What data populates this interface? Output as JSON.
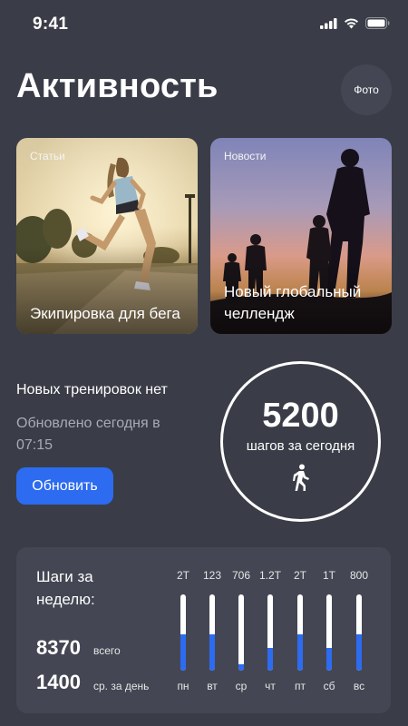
{
  "status_bar": {
    "time": "9:41",
    "icons": [
      "cellular-signal-icon",
      "wifi-icon",
      "battery-icon"
    ]
  },
  "header": {
    "title": "Активность",
    "photo_button": "Фото"
  },
  "cards": [
    {
      "category": "Статьи",
      "title": "Экипировка для бега",
      "image": "runner-sunset-photo"
    },
    {
      "category": "Новости",
      "title": "Новый глобальный челлендж",
      "image": "silhouettes-sunset-photo"
    }
  ],
  "workout": {
    "status": "Новых тренировок нет",
    "updated": "Обновлено сегодня в 07:15",
    "refresh_button": "Обновить"
  },
  "steps": {
    "count": "5200",
    "label": "шагов за сегодня",
    "icon": "walking-person-icon"
  },
  "weekly": {
    "title": "Шаги за неделю:",
    "total_value": "8370",
    "total_label": "всего",
    "avg_value": "1400",
    "avg_label": "ср. за день",
    "days": [
      {
        "label": "пн",
        "value": "2Т",
        "fill": 0.48
      },
      {
        "label": "вт",
        "value": "123",
        "fill": 0.48
      },
      {
        "label": "ср",
        "value": "706",
        "fill": 0.08
      },
      {
        "label": "чт",
        "value": "1.2Т",
        "fill": 0.3
      },
      {
        "label": "пт",
        "value": "2Т",
        "fill": 0.48
      },
      {
        "label": "сб",
        "value": "1Т",
        "fill": 0.3
      },
      {
        "label": "вс",
        "value": "800",
        "fill": 0.48
      }
    ]
  },
  "colors": {
    "background": "#3a3d47",
    "panel": "#444753",
    "accent": "#2d6bf0",
    "muted_text": "#a9abb3"
  }
}
